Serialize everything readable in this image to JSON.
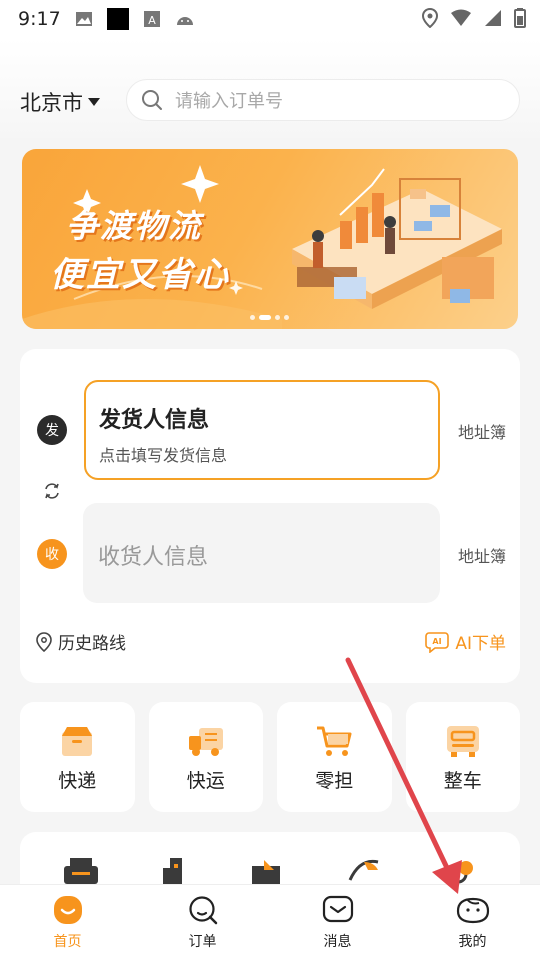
{
  "status_bar": {
    "time": "9:17"
  },
  "header": {
    "city": "北京市",
    "search_placeholder": "请输入订单号"
  },
  "banner": {
    "slogan_line1": "争渡物流",
    "slogan_line2": "便宜又省心"
  },
  "shipping": {
    "sender_badge": "发",
    "sender_title": "发货人信息",
    "sender_hint": "点击填写发货信息",
    "receiver_badge": "收",
    "receiver_title": "收货人信息",
    "address_book": "地址簿",
    "history_route": "历史路线",
    "ai_order": "AI下单"
  },
  "services": [
    {
      "label": "快递",
      "icon": "box-icon"
    },
    {
      "label": "快运",
      "icon": "truck-icon"
    },
    {
      "label": "零担",
      "icon": "cart-icon"
    },
    {
      "label": "整车",
      "icon": "lorry-icon"
    }
  ],
  "tabbar": [
    {
      "label": "首页",
      "icon": "home-icon",
      "active": true
    },
    {
      "label": "订单",
      "icon": "order-search-icon",
      "active": false
    },
    {
      "label": "消息",
      "icon": "message-icon",
      "active": false
    },
    {
      "label": "我的",
      "icon": "profile-icon",
      "active": false
    }
  ],
  "colors": {
    "accent": "#f7941d",
    "annotation_arrow": "#e0454b"
  }
}
